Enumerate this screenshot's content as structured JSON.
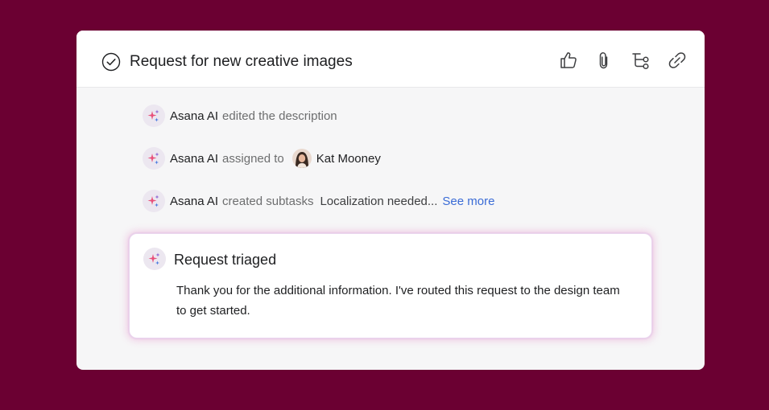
{
  "task": {
    "title": "Request for new creative images"
  },
  "header_actions": [
    {
      "icon": "thumbs-up-icon"
    },
    {
      "icon": "paperclip-icon"
    },
    {
      "icon": "subtask-icon"
    },
    {
      "icon": "link-icon"
    }
  ],
  "activity": [
    {
      "actor": "Asana AI",
      "verb": "edited the description"
    },
    {
      "actor": "Asana AI",
      "verb": "assigned to",
      "assignee": "Kat Mooney"
    },
    {
      "actor": "Asana AI",
      "verb": "created subtasks",
      "subtask": "Localization needed...",
      "link": "See more"
    }
  ],
  "triage": {
    "title": "Request triaged",
    "message": "Thank you for the additional information. I've routed this request to the design team to get started."
  },
  "colors": {
    "background": "#6b0032",
    "link": "#3a6bd6",
    "sparkle_pink": "#e8507a",
    "sparkle_purple": "#8a63d2",
    "sparkle_blue": "#4c7be0"
  }
}
